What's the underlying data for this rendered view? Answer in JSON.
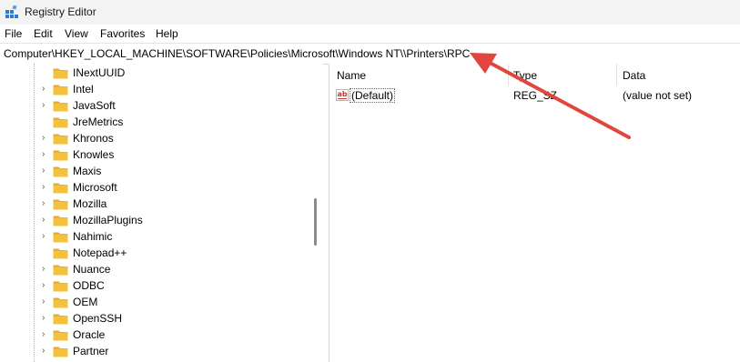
{
  "window": {
    "title": "Registry Editor"
  },
  "menu": [
    "File",
    "Edit",
    "View",
    "Favorites",
    "Help"
  ],
  "address": {
    "value": "Computer\\HKEY_LOCAL_MACHINE\\SOFTWARE\\Policies\\Microsoft\\Windows NT\\\\Printers\\RPC"
  },
  "tree": {
    "items": [
      {
        "label": "INextUUID",
        "expandable": false
      },
      {
        "label": "Intel",
        "expandable": true
      },
      {
        "label": "JavaSoft",
        "expandable": true
      },
      {
        "label": "JreMetrics",
        "expandable": false
      },
      {
        "label": "Khronos",
        "expandable": true
      },
      {
        "label": "Knowles",
        "expandable": true
      },
      {
        "label": "Maxis",
        "expandable": true
      },
      {
        "label": "Microsoft",
        "expandable": true
      },
      {
        "label": "Mozilla",
        "expandable": true
      },
      {
        "label": "MozillaPlugins",
        "expandable": true
      },
      {
        "label": "Nahimic",
        "expandable": true
      },
      {
        "label": "Notepad++",
        "expandable": false
      },
      {
        "label": "Nuance",
        "expandable": true
      },
      {
        "label": "ODBC",
        "expandable": true
      },
      {
        "label": "OEM",
        "expandable": true
      },
      {
        "label": "OpenSSH",
        "expandable": true
      },
      {
        "label": "Oracle",
        "expandable": true
      },
      {
        "label": "Partner",
        "expandable": true
      }
    ]
  },
  "list": {
    "columns": [
      "Name",
      "Type",
      "Data"
    ],
    "rows": [
      {
        "name": "(Default)",
        "type": "REG_SZ",
        "data": "(value not set)"
      }
    ]
  },
  "colors": {
    "folder": "#f3c13a",
    "arrow": "#e0463d",
    "value_icon": "#c0392b"
  }
}
